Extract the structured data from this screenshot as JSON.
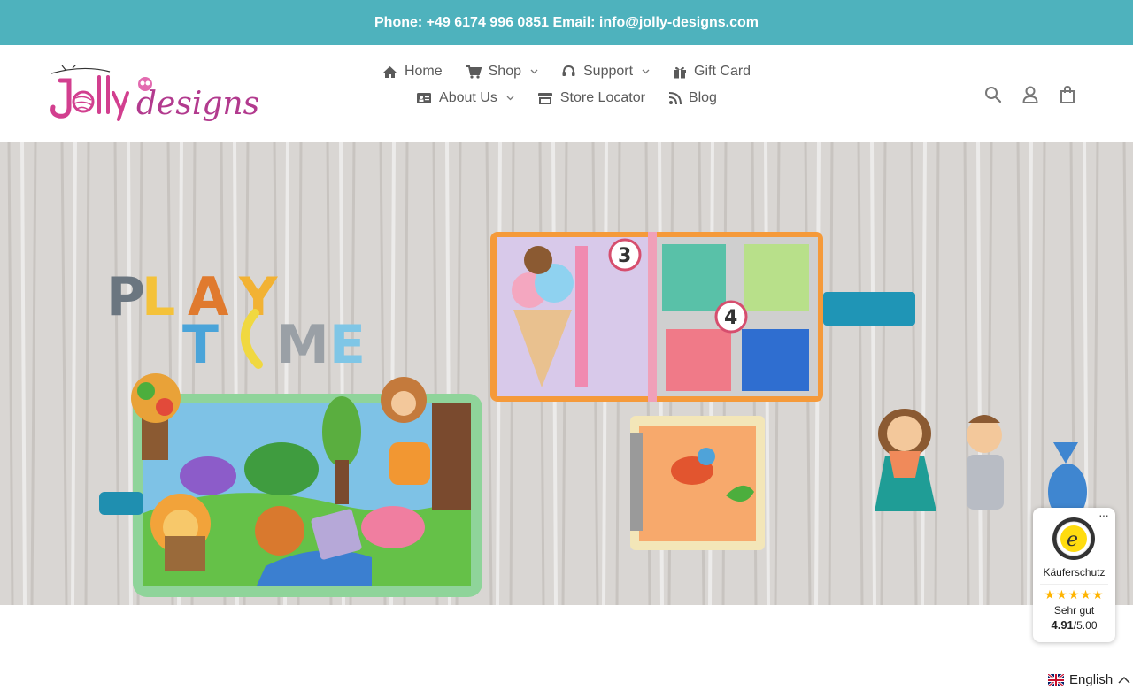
{
  "topbar": {
    "text": "Phone: +49 6174 996 0851 Email: info@jolly-designs.com"
  },
  "logo": {
    "text": "Jolly designs",
    "brand_color": "#d23f8f"
  },
  "nav": {
    "items": [
      {
        "label": "Home",
        "icon": "home-icon"
      },
      {
        "label": "Shop",
        "icon": "cart-icon",
        "dropdown": true
      },
      {
        "label": "Support",
        "icon": "headset-icon",
        "dropdown": true
      },
      {
        "label": "Gift Card",
        "icon": "gift-icon"
      },
      {
        "label": "About Us",
        "icon": "id-card-icon",
        "dropdown": true
      },
      {
        "label": "Store Locator",
        "icon": "store-icon"
      },
      {
        "label": "Blog",
        "icon": "rss-icon"
      }
    ]
  },
  "header_icons": [
    "search-icon",
    "account-icon",
    "bag-icon"
  ],
  "hero": {
    "text_play": "PLAY",
    "text_time": "TIME",
    "page_numbers": [
      "3",
      "4"
    ]
  },
  "trust_badge": {
    "label": "Käuferschutz",
    "stars": "★★★★★",
    "rating_text": "Sehr gut",
    "score": "4.91",
    "score_max": "/5.00",
    "menu": "···"
  },
  "language": {
    "label": "English"
  },
  "colors": {
    "topbar": "#4eb2bd",
    "nav_text": "#5a5a5a",
    "logo_pink": "#d23f8f",
    "stars": "#ffb400"
  }
}
